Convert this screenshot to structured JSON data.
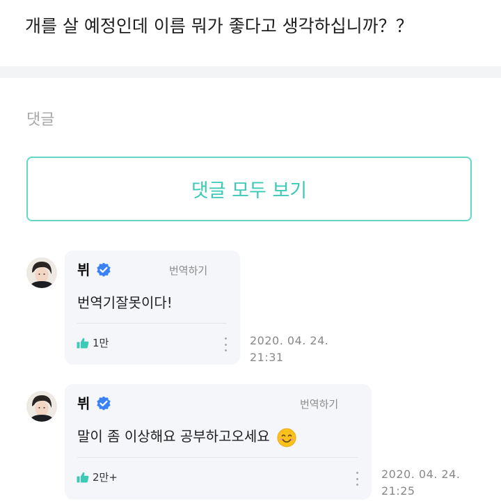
{
  "post": {
    "title": "개를 살 예정인데 이름 뭐가 좋다고 생각하십니까？？"
  },
  "comments_section": {
    "label": "댓글",
    "view_all_label": "댓글 모두 보기"
  },
  "colors": {
    "accent": "#3cc9b6",
    "verified": "#3b82f6",
    "like": "#3cc9b6"
  },
  "comments": [
    {
      "author": "뷔",
      "translate_label": "번역하기",
      "text": "번역기잘못이다!",
      "likes": "1만",
      "date": "2020. 04. 24.",
      "time": "21:31"
    },
    {
      "author": "뷔",
      "translate_label": "번역하기",
      "text": "말이 좀 이상해요 공부하고오세요",
      "likes": "2만+",
      "date": "2020. 04. 24.",
      "time": "21:25"
    }
  ]
}
